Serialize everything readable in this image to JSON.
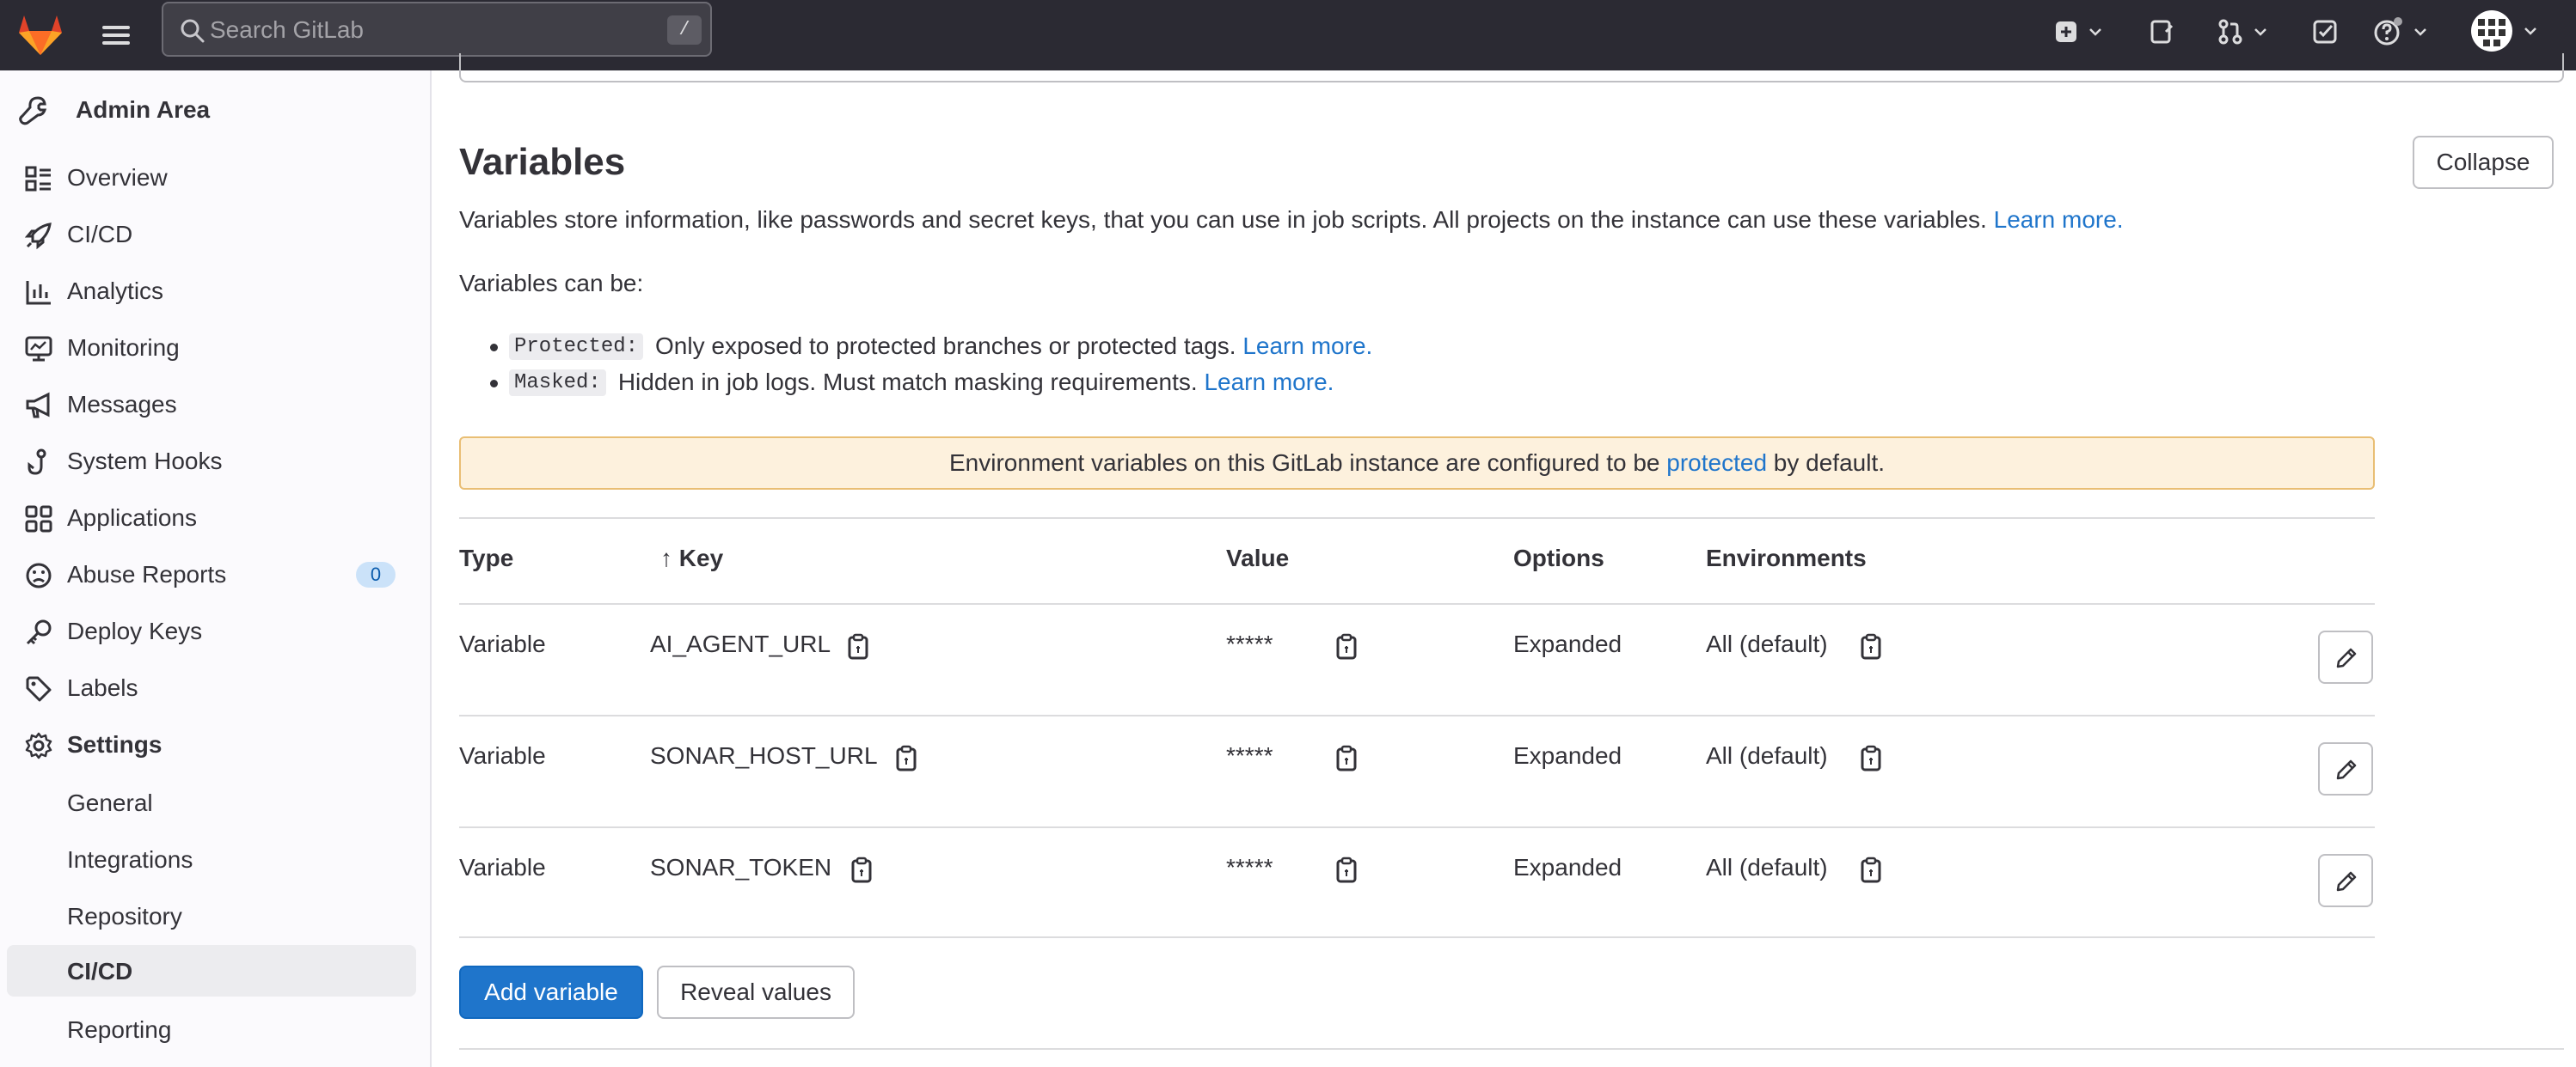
{
  "topbar": {
    "search_placeholder": "Search GitLab",
    "search_shortcut": "/"
  },
  "sidebar": {
    "title": "Admin Area",
    "items": [
      {
        "label": "Overview"
      },
      {
        "label": "CI/CD"
      },
      {
        "label": "Analytics"
      },
      {
        "label": "Monitoring"
      },
      {
        "label": "Messages"
      },
      {
        "label": "System Hooks"
      },
      {
        "label": "Applications"
      },
      {
        "label": "Abuse Reports",
        "badge": "0"
      },
      {
        "label": "Deploy Keys"
      },
      {
        "label": "Labels"
      },
      {
        "label": "Settings"
      }
    ],
    "settings_sub": [
      {
        "label": "General"
      },
      {
        "label": "Integrations"
      },
      {
        "label": "Repository"
      },
      {
        "label": "CI/CD",
        "active": true
      },
      {
        "label": "Reporting"
      }
    ]
  },
  "variables": {
    "title": "Variables",
    "collapse_label": "Collapse",
    "description": "Variables store information, like passwords and secret keys, that you can use in job scripts. All projects on the instance can use these variables.",
    "learn_more": "Learn more.",
    "can_be": "Variables can be:",
    "bullets": [
      {
        "code": "Protected:",
        "text": "Only exposed to protected branches or protected tags.",
        "link": "Learn more."
      },
      {
        "code": "Masked:",
        "text": "Hidden in job logs. Must match masking requirements.",
        "link": "Learn more."
      }
    ],
    "alert": {
      "prefix": "Environment variables on this GitLab instance are configured to be",
      "link": "protected",
      "suffix": "by default."
    },
    "table": {
      "headers": {
        "type": "Type",
        "key": "Key",
        "value": "Value",
        "options": "Options",
        "environments": "Environments"
      },
      "sort_arrow": "↑",
      "rows": [
        {
          "type": "Variable",
          "key": "AI_AGENT_URL",
          "value": "*****",
          "options": "Expanded",
          "environment": "All (default)"
        },
        {
          "type": "Variable",
          "key": "SONAR_HOST_URL",
          "value": "*****",
          "options": "Expanded",
          "environment": "All (default)"
        },
        {
          "type": "Variable",
          "key": "SONAR_TOKEN",
          "value": "*****",
          "options": "Expanded",
          "environment": "All (default)"
        }
      ]
    },
    "add_label": "Add variable",
    "reveal_label": "Reveal values"
  },
  "colors": {
    "topbar_bg": "#2b2a33",
    "primary": "#1f75cb",
    "alert_bg": "#fdf1dd",
    "alert_border": "#e9be74"
  }
}
